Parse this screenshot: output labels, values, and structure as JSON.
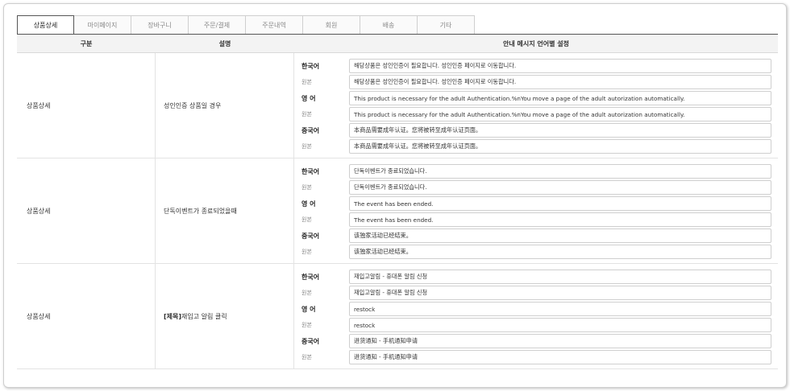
{
  "tabs": [
    "상품상세",
    "마이페이지",
    "장바구니",
    "주문/결제",
    "주문내역",
    "회원",
    "배송",
    "기타"
  ],
  "headers": {
    "category": "구분",
    "description": "설명",
    "settings": "안내 메시지 언어별 설정"
  },
  "rows": [
    {
      "category": "상품상세",
      "description": "성인인증 상품일 경우",
      "langs": [
        {
          "label": "한국어",
          "value": "해당상품은 성인인증이 필요합니다. 성인인증 페이지로 이동합니다."
        },
        {
          "label": "원본",
          "value": "해당상품은 성인인증이 필요합니다. 성인인증 페이지로 이동합니다."
        },
        {
          "label": "영 어",
          "value": "This product is necessary for the adult Authentication.%nYou move a page of the adult autorization automatically."
        },
        {
          "label": "원본",
          "value": "This product is necessary for the adult Authentication.%nYou move a page of the adult autorization automatically."
        },
        {
          "label": "중국어",
          "value": "本商品需要成年认证。您将被转至成年认证页面。"
        },
        {
          "label": "원본",
          "value": "本商品需要成年认证。您将被转至成年认证页面。"
        }
      ]
    },
    {
      "category": "상품상세",
      "description": "단독이벤트가 종료되었을때",
      "langs": [
        {
          "label": "한국어",
          "value": "단독이벤트가 종료되었습니다."
        },
        {
          "label": "원본",
          "value": "단독이벤트가 종료되었습니다."
        },
        {
          "label": "영 어",
          "value": "The event has been ended."
        },
        {
          "label": "원본",
          "value": "The event has been ended."
        },
        {
          "label": "중국어",
          "value": "该独家活动已经结束。"
        },
        {
          "label": "원본",
          "value": "该独家活动已经结束。"
        }
      ]
    },
    {
      "category": "상품상세",
      "description_prefix": "[제목]",
      "description": " 재입고 알림 클릭",
      "langs": [
        {
          "label": "한국어",
          "value": "재입고알림 - 휴대폰 알림 신청"
        },
        {
          "label": "원본",
          "value": "재입고알림 - 휴대폰 알림 신청"
        },
        {
          "label": "영 어",
          "value": "restock"
        },
        {
          "label": "원본",
          "value": "restock"
        },
        {
          "label": "중국어",
          "value": "进货通知 - 手机通知申请"
        },
        {
          "label": "원본",
          "value": "进货通知 - 手机通知申请"
        }
      ]
    }
  ]
}
